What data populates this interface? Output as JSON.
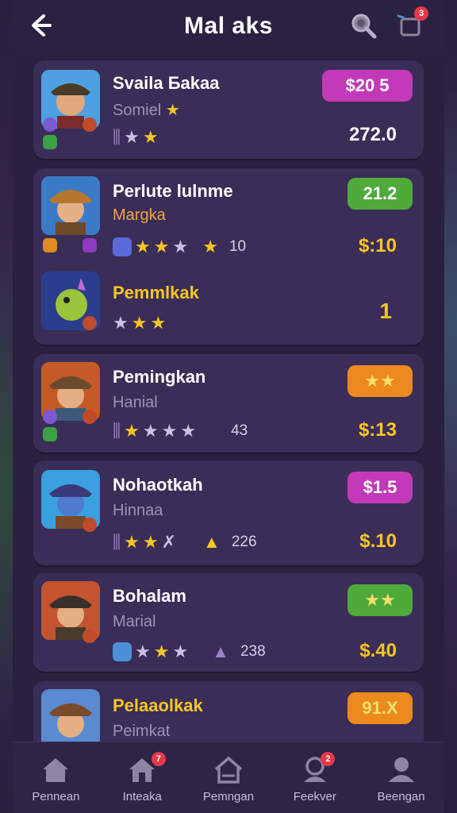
{
  "header": {
    "title": "Mal aks",
    "cart_badge": "3"
  },
  "items": [
    {
      "title": "Svaila Бakaa",
      "subtitle": "Somiel",
      "pill": "$20 5",
      "price": "272.0",
      "count": ""
    },
    {
      "title": "Perlute lulnme",
      "subtitle": "Margka",
      "pill": "21.2",
      "price": "$:10",
      "count": "10"
    },
    {
      "title": "Pemmlkak",
      "subtitle": "",
      "pill": "",
      "price": "1",
      "count": ""
    },
    {
      "title": "Pemingkan",
      "subtitle": "Hanial",
      "pill": "★★",
      "price": "$:13",
      "count": "43"
    },
    {
      "title": "Nohaotkah",
      "subtitle": "Hinnaa",
      "pill": "$1.5",
      "price": "$.10",
      "count": "226"
    },
    {
      "title": "Bohalam",
      "subtitle": "Marial",
      "pill": "★★",
      "price": "$.40",
      "count": "238"
    },
    {
      "title": "Pelaaolkak",
      "subtitle": "Peimkat",
      "pill": "91.X",
      "price": "",
      "count": ""
    }
  ],
  "nav": [
    {
      "label": "Pennean",
      "icon": "home-icon",
      "badge": ""
    },
    {
      "label": "Inteaka",
      "icon": "store-icon",
      "badge": "7"
    },
    {
      "label": "Pemngan",
      "icon": "house-outline-icon",
      "badge": ""
    },
    {
      "label": "Feekver",
      "icon": "user-badge-icon",
      "badge": "2"
    },
    {
      "label": "Beengan",
      "icon": "profile-icon",
      "badge": ""
    }
  ],
  "colors": {
    "gold": "#f6c623",
    "magenta_pill": "#c23ab8",
    "green_pill": "#4faa3b",
    "orange_pill": "#ec8a1e",
    "card": "#3a2d57"
  }
}
